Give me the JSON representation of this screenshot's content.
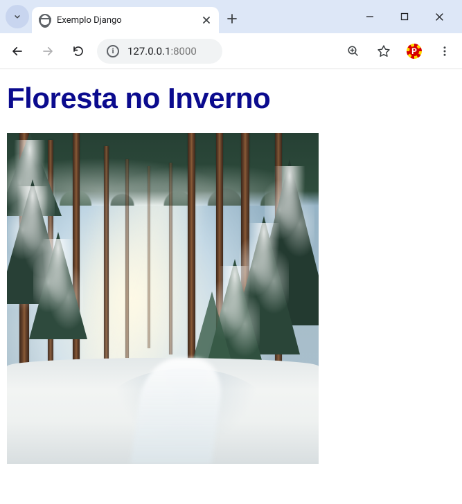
{
  "browser": {
    "tab_title": "Exemplo Django",
    "address_host": "127.0.0.1",
    "address_port": ":8000"
  },
  "page": {
    "heading": "Floresta no Inverno",
    "image_alt": "Winter forest with snowy pines"
  }
}
